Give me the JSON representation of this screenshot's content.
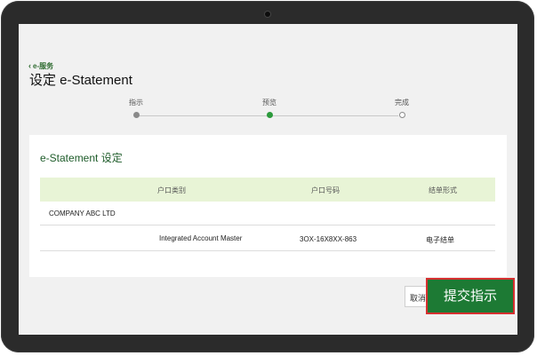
{
  "back_link": {
    "icon": "chevron-left-icon",
    "label": "e-服务"
  },
  "page_title": "设定 e-Statement",
  "stepper": {
    "steps": [
      {
        "label": "指示",
        "state": "done"
      },
      {
        "label": "预览",
        "state": "current"
      },
      {
        "label": "完成",
        "state": "pending"
      }
    ]
  },
  "card": {
    "title": "e-Statement 设定",
    "table": {
      "headers": [
        "户口类别",
        "户口号码",
        "结单形式"
      ],
      "group_label": "COMPANY ABC LTD",
      "rows": [
        {
          "account_type": "Integrated Account Master",
          "account_number": "3OX-16X8XX-863",
          "statement_format": "电子结单"
        }
      ]
    }
  },
  "buttons": {
    "cancel": "取消",
    "submit": "提交指示"
  },
  "colors": {
    "accent_green": "#1d7a34",
    "header_bg": "#e8f4d6",
    "highlight_border": "#d63030"
  }
}
